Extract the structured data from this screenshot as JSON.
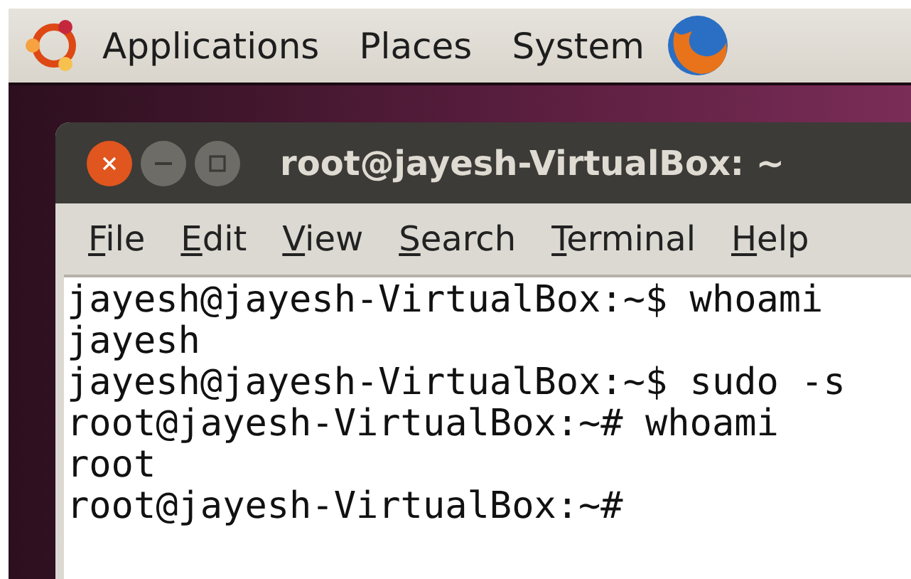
{
  "top_panel": {
    "menus": [
      "Applications",
      "Places",
      "System"
    ]
  },
  "terminal_window": {
    "title": "root@jayesh-VirtualBox: ~",
    "menu_bar": [
      "File",
      "Edit",
      "View",
      "Search",
      "Terminal",
      "Help"
    ],
    "lines": [
      "jayesh@jayesh-VirtualBox:~$ whoami",
      "jayesh",
      "jayesh@jayesh-VirtualBox:~$ sudo -s",
      "root@jayesh-VirtualBox:~# whoami",
      "root",
      "root@jayesh-VirtualBox:~#"
    ]
  }
}
